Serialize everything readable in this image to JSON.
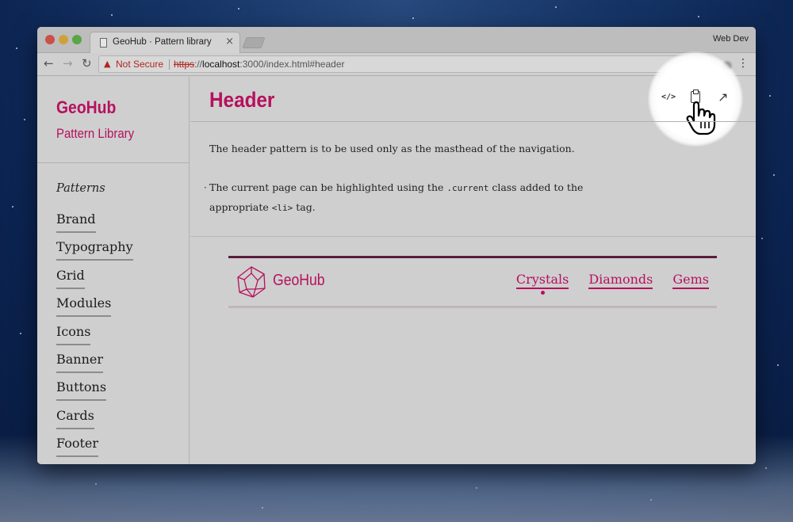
{
  "browser": {
    "tab_title": "GeoHub · Pattern library",
    "tab_close": "×",
    "profile_label": "Web Dev",
    "security_label": "Not Secure",
    "url_protocol": "https",
    "url_sep": "://",
    "url_host": "localhost",
    "url_path": ":3000/index.html#header"
  },
  "sidebar": {
    "brand": "GeoHub",
    "subtitle": "Pattern Library",
    "section_label": "Patterns",
    "items": [
      {
        "label": "Brand"
      },
      {
        "label": "Typography"
      },
      {
        "label": "Grid"
      },
      {
        "label": "Modules"
      },
      {
        "label": "Icons"
      },
      {
        "label": "Banner"
      },
      {
        "label": "Buttons"
      },
      {
        "label": "Cards"
      },
      {
        "label": "Footer"
      }
    ]
  },
  "main": {
    "title": "Header",
    "tools": {
      "code_label": "</>"
    },
    "description": "The header pattern is to be used only as the masthead of the navigation.",
    "note_pre": "The current page can be highlighted using the ",
    "note_code1": ".current",
    "note_mid": " class added to the appropriate ",
    "note_code2": "<li>",
    "note_post": " tag."
  },
  "demo_header": {
    "brand": "GeoHub",
    "nav": [
      {
        "label": "Crystals",
        "current": true
      },
      {
        "label": "Diamonds",
        "current": false
      },
      {
        "label": "Gems",
        "current": false
      }
    ]
  },
  "colors": {
    "brand": "#b6105e",
    "header_bar": "#5c1b3f",
    "not_secure": "#b0261e"
  },
  "icons": [
    "back-arrow-icon",
    "forward-arrow-icon",
    "reload-icon",
    "warning-icon",
    "star-icon",
    "extension-icon",
    "kebab-menu-icon",
    "code-icon",
    "clipboard-icon",
    "expand-icon",
    "hand-pointer-icon",
    "crystal-logo-icon",
    "document-icon"
  ]
}
